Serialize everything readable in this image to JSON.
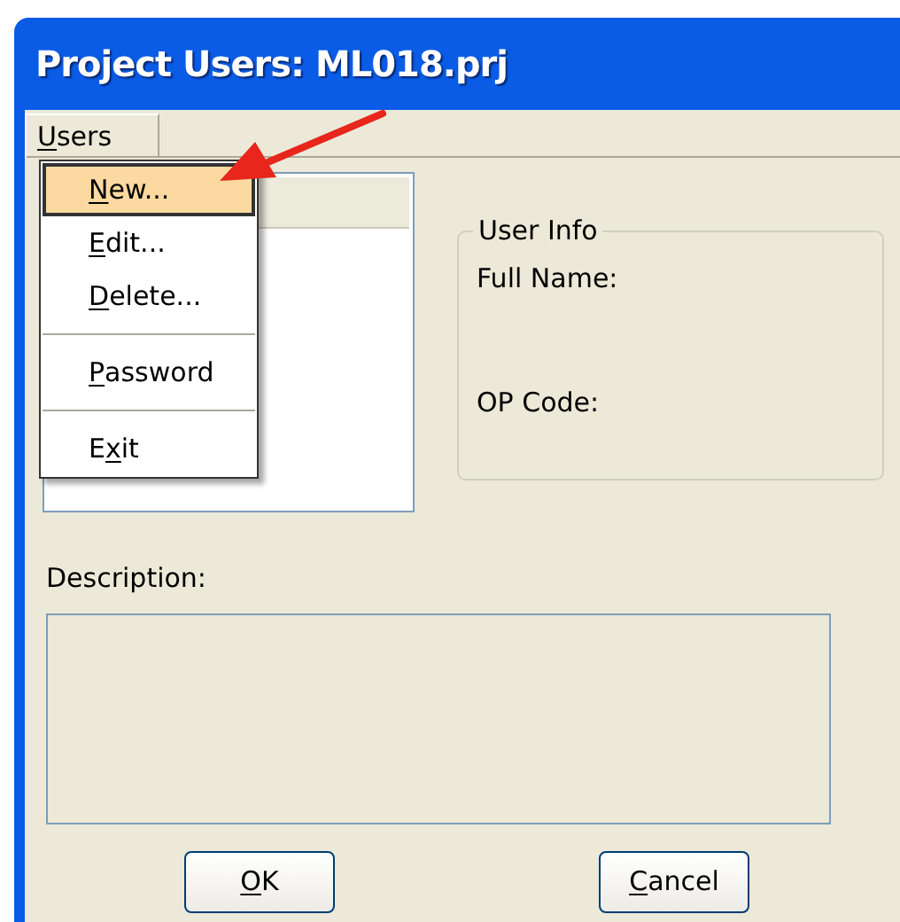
{
  "window": {
    "title": "Project Users: ML018.prj"
  },
  "menu_bar": [
    {
      "access_key": "U",
      "text_after": "sers",
      "open": true
    }
  ],
  "menu": {
    "items": [
      {
        "kind": "item",
        "access_key": "N",
        "text_after": "ew...",
        "selected": true
      },
      {
        "kind": "item",
        "access_key": "E",
        "text_after": "dit...",
        "selected": false
      },
      {
        "kind": "item",
        "access_key": "D",
        "text_after": "elete...",
        "selected": false
      },
      {
        "kind": "separator"
      },
      {
        "kind": "item",
        "access_key": "P",
        "text_after": "assword",
        "selected": false
      },
      {
        "kind": "separator"
      },
      {
        "kind": "item",
        "text_before": "E",
        "access_key": "x",
        "text_after": "it",
        "selected": false
      }
    ]
  },
  "user_info": {
    "title": "User Info",
    "fields": [
      {
        "label": "Full Name:"
      },
      {
        "label": "OP Code:"
      }
    ]
  },
  "description": {
    "label": "Description:"
  },
  "buttons": [
    {
      "access_key": "O",
      "text_after": "K"
    },
    {
      "access_key": "C",
      "text_after": "ancel"
    }
  ]
}
